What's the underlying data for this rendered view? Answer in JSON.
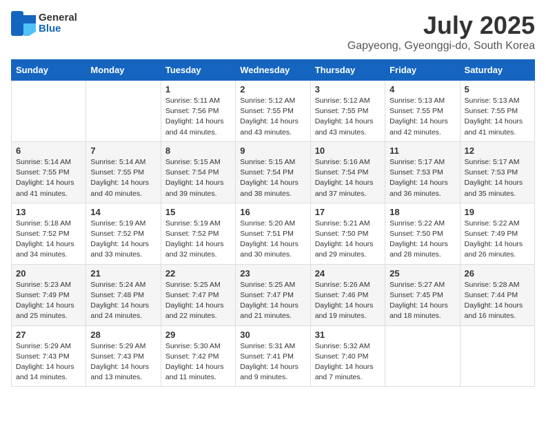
{
  "header": {
    "logo_general": "General",
    "logo_blue": "Blue",
    "month": "July 2025",
    "location": "Gapyeong, Gyeonggi-do, South Korea"
  },
  "days_of_week": [
    "Sunday",
    "Monday",
    "Tuesday",
    "Wednesday",
    "Thursday",
    "Friday",
    "Saturday"
  ],
  "weeks": [
    [
      {
        "day": "",
        "sunrise": "",
        "sunset": "",
        "daylight": ""
      },
      {
        "day": "",
        "sunrise": "",
        "sunset": "",
        "daylight": ""
      },
      {
        "day": "1",
        "sunrise": "Sunrise: 5:11 AM",
        "sunset": "Sunset: 7:56 PM",
        "daylight": "Daylight: 14 hours and 44 minutes."
      },
      {
        "day": "2",
        "sunrise": "Sunrise: 5:12 AM",
        "sunset": "Sunset: 7:55 PM",
        "daylight": "Daylight: 14 hours and 43 minutes."
      },
      {
        "day": "3",
        "sunrise": "Sunrise: 5:12 AM",
        "sunset": "Sunset: 7:55 PM",
        "daylight": "Daylight: 14 hours and 43 minutes."
      },
      {
        "day": "4",
        "sunrise": "Sunrise: 5:13 AM",
        "sunset": "Sunset: 7:55 PM",
        "daylight": "Daylight: 14 hours and 42 minutes."
      },
      {
        "day": "5",
        "sunrise": "Sunrise: 5:13 AM",
        "sunset": "Sunset: 7:55 PM",
        "daylight": "Daylight: 14 hours and 41 minutes."
      }
    ],
    [
      {
        "day": "6",
        "sunrise": "Sunrise: 5:14 AM",
        "sunset": "Sunset: 7:55 PM",
        "daylight": "Daylight: 14 hours and 41 minutes."
      },
      {
        "day": "7",
        "sunrise": "Sunrise: 5:14 AM",
        "sunset": "Sunset: 7:55 PM",
        "daylight": "Daylight: 14 hours and 40 minutes."
      },
      {
        "day": "8",
        "sunrise": "Sunrise: 5:15 AM",
        "sunset": "Sunset: 7:54 PM",
        "daylight": "Daylight: 14 hours and 39 minutes."
      },
      {
        "day": "9",
        "sunrise": "Sunrise: 5:15 AM",
        "sunset": "Sunset: 7:54 PM",
        "daylight": "Daylight: 14 hours and 38 minutes."
      },
      {
        "day": "10",
        "sunrise": "Sunrise: 5:16 AM",
        "sunset": "Sunset: 7:54 PM",
        "daylight": "Daylight: 14 hours and 37 minutes."
      },
      {
        "day": "11",
        "sunrise": "Sunrise: 5:17 AM",
        "sunset": "Sunset: 7:53 PM",
        "daylight": "Daylight: 14 hours and 36 minutes."
      },
      {
        "day": "12",
        "sunrise": "Sunrise: 5:17 AM",
        "sunset": "Sunset: 7:53 PM",
        "daylight": "Daylight: 14 hours and 35 minutes."
      }
    ],
    [
      {
        "day": "13",
        "sunrise": "Sunrise: 5:18 AM",
        "sunset": "Sunset: 7:52 PM",
        "daylight": "Daylight: 14 hours and 34 minutes."
      },
      {
        "day": "14",
        "sunrise": "Sunrise: 5:19 AM",
        "sunset": "Sunset: 7:52 PM",
        "daylight": "Daylight: 14 hours and 33 minutes."
      },
      {
        "day": "15",
        "sunrise": "Sunrise: 5:19 AM",
        "sunset": "Sunset: 7:52 PM",
        "daylight": "Daylight: 14 hours and 32 minutes."
      },
      {
        "day": "16",
        "sunrise": "Sunrise: 5:20 AM",
        "sunset": "Sunset: 7:51 PM",
        "daylight": "Daylight: 14 hours and 30 minutes."
      },
      {
        "day": "17",
        "sunrise": "Sunrise: 5:21 AM",
        "sunset": "Sunset: 7:50 PM",
        "daylight": "Daylight: 14 hours and 29 minutes."
      },
      {
        "day": "18",
        "sunrise": "Sunrise: 5:22 AM",
        "sunset": "Sunset: 7:50 PM",
        "daylight": "Daylight: 14 hours and 28 minutes."
      },
      {
        "day": "19",
        "sunrise": "Sunrise: 5:22 AM",
        "sunset": "Sunset: 7:49 PM",
        "daylight": "Daylight: 14 hours and 26 minutes."
      }
    ],
    [
      {
        "day": "20",
        "sunrise": "Sunrise: 5:23 AM",
        "sunset": "Sunset: 7:49 PM",
        "daylight": "Daylight: 14 hours and 25 minutes."
      },
      {
        "day": "21",
        "sunrise": "Sunrise: 5:24 AM",
        "sunset": "Sunset: 7:48 PM",
        "daylight": "Daylight: 14 hours and 24 minutes."
      },
      {
        "day": "22",
        "sunrise": "Sunrise: 5:25 AM",
        "sunset": "Sunset: 7:47 PM",
        "daylight": "Daylight: 14 hours and 22 minutes."
      },
      {
        "day": "23",
        "sunrise": "Sunrise: 5:25 AM",
        "sunset": "Sunset: 7:47 PM",
        "daylight": "Daylight: 14 hours and 21 minutes."
      },
      {
        "day": "24",
        "sunrise": "Sunrise: 5:26 AM",
        "sunset": "Sunset: 7:46 PM",
        "daylight": "Daylight: 14 hours and 19 minutes."
      },
      {
        "day": "25",
        "sunrise": "Sunrise: 5:27 AM",
        "sunset": "Sunset: 7:45 PM",
        "daylight": "Daylight: 14 hours and 18 minutes."
      },
      {
        "day": "26",
        "sunrise": "Sunrise: 5:28 AM",
        "sunset": "Sunset: 7:44 PM",
        "daylight": "Daylight: 14 hours and 16 minutes."
      }
    ],
    [
      {
        "day": "27",
        "sunrise": "Sunrise: 5:29 AM",
        "sunset": "Sunset: 7:43 PM",
        "daylight": "Daylight: 14 hours and 14 minutes."
      },
      {
        "day": "28",
        "sunrise": "Sunrise: 5:29 AM",
        "sunset": "Sunset: 7:43 PM",
        "daylight": "Daylight: 14 hours and 13 minutes."
      },
      {
        "day": "29",
        "sunrise": "Sunrise: 5:30 AM",
        "sunset": "Sunset: 7:42 PM",
        "daylight": "Daylight: 14 hours and 11 minutes."
      },
      {
        "day": "30",
        "sunrise": "Sunrise: 5:31 AM",
        "sunset": "Sunset: 7:41 PM",
        "daylight": "Daylight: 14 hours and 9 minutes."
      },
      {
        "day": "31",
        "sunrise": "Sunrise: 5:32 AM",
        "sunset": "Sunset: 7:40 PM",
        "daylight": "Daylight: 14 hours and 7 minutes."
      },
      {
        "day": "",
        "sunrise": "",
        "sunset": "",
        "daylight": ""
      },
      {
        "day": "",
        "sunrise": "",
        "sunset": "",
        "daylight": ""
      }
    ]
  ]
}
